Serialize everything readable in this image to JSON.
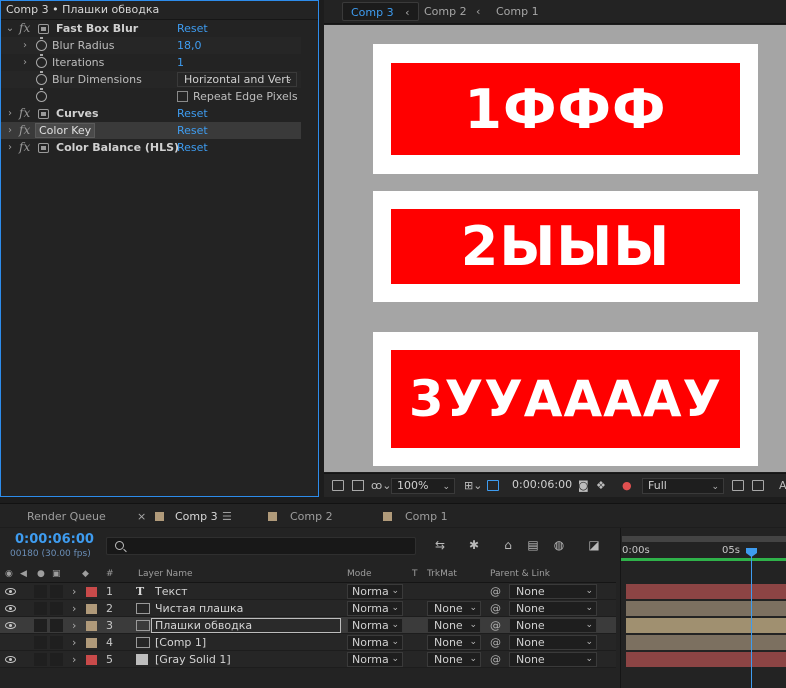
{
  "effect_controls": {
    "header": "Comp 3 • Плашки обводка",
    "effects": [
      {
        "name": "Fast Box Blur",
        "reset": "Reset",
        "properties": [
          {
            "name": "Blur Radius",
            "value": "18,0"
          },
          {
            "name": "Iterations",
            "value": "1"
          },
          {
            "name": "Blur Dimensions",
            "value": "Horizontal and Vert"
          },
          {
            "name": "",
            "checkbox_label": "Repeat Edge Pixels",
            "checked": false
          }
        ]
      },
      {
        "name": "Curves",
        "reset": "Reset"
      },
      {
        "name": "Color Key",
        "reset": "Reset"
      },
      {
        "name": "Color Balance (HLS)",
        "reset": "Reset"
      }
    ]
  },
  "composition": {
    "tabs": [
      "Comp 3",
      "Comp 2",
      "Comp 1"
    ],
    "plates": [
      "1ФФФ",
      "2ЫЫЫ",
      "3УУААААУ"
    ],
    "colors": {
      "plate_red": "#ff0000",
      "plate_white": "#ffffff",
      "background": "#a5a5a5"
    },
    "toolbar": {
      "zoom": "100%",
      "timecode": "0:00:06:00",
      "resolution": "Full",
      "trailing": "A"
    }
  },
  "timeline": {
    "tabs": [
      {
        "label": "Render Queue"
      },
      {
        "label": "Comp 3",
        "swatch": "#b09a7a"
      },
      {
        "label": "Comp 2",
        "swatch": "#b09a7a"
      },
      {
        "label": "Comp 1",
        "swatch": "#b09a7a"
      }
    ],
    "timecode": "0:00:06:00",
    "frames": "00180 (30.00 fps)",
    "columns": {
      "hash": "#",
      "layer_name": "Layer Name",
      "mode": "Mode",
      "t": "T",
      "trkmat": "TrkMat",
      "parent": "Parent & Link"
    },
    "layers": [
      {
        "num": "1",
        "name": "Текст",
        "type": "text",
        "label": "#c94a4a",
        "mode": "Norma",
        "trkmat": "",
        "parent": "None",
        "bar": "#8c4444"
      },
      {
        "num": "2",
        "name": "Чистая плашка",
        "type": "comp",
        "label": "#b09a7a",
        "mode": "Norma",
        "trkmat": "None",
        "parent": "None",
        "bar": "#7c7060"
      },
      {
        "num": "3",
        "name": "Плашки обводка",
        "type": "comp",
        "label": "#b09a7a",
        "mode": "Norma",
        "trkmat": "None",
        "parent": "None",
        "bar": "#a09070"
      },
      {
        "num": "4",
        "name": "[Comp 1]",
        "type": "comp",
        "label": "#b09a7a",
        "mode": "Norma",
        "trkmat": "None",
        "parent": "None",
        "bar": "#7c7060"
      },
      {
        "num": "5",
        "name": "[Gray Solid 1]",
        "type": "solid",
        "label": "#c94a4a",
        "mode": "Norma",
        "trkmat": "None",
        "parent": "None",
        "bar": "#8c4444"
      }
    ],
    "ruler": {
      "start": "0:00s",
      "mark": "05s"
    }
  }
}
